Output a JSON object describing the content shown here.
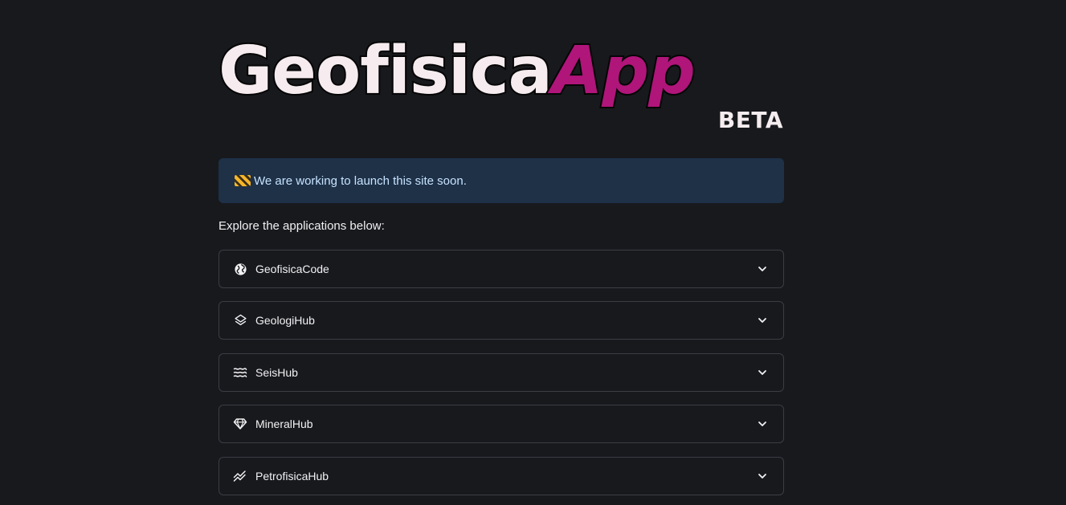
{
  "logo": {
    "part1": "Geofisica",
    "part2": "App",
    "badge": "BETA"
  },
  "alert": {
    "text": "We are working to launch this site soon.",
    "icon": "construction-icon"
  },
  "intro": "Explore the applications below:",
  "apps": [
    {
      "label": "GeofisicaCode",
      "icon": "globe-icon"
    },
    {
      "label": "GeologiHub",
      "icon": "layers-icon"
    },
    {
      "label": "SeisHub",
      "icon": "waves-icon"
    },
    {
      "label": "MineralHub",
      "icon": "diamond-icon"
    },
    {
      "label": "PetrofisicaHub",
      "icon": "trend-icon"
    }
  ],
  "colors": {
    "background": "#18191d",
    "alert_bg": "#1e3147",
    "alert_text": "#c7e3ff",
    "brand_magenta": "#b0157a",
    "border": "#3b3d45"
  }
}
